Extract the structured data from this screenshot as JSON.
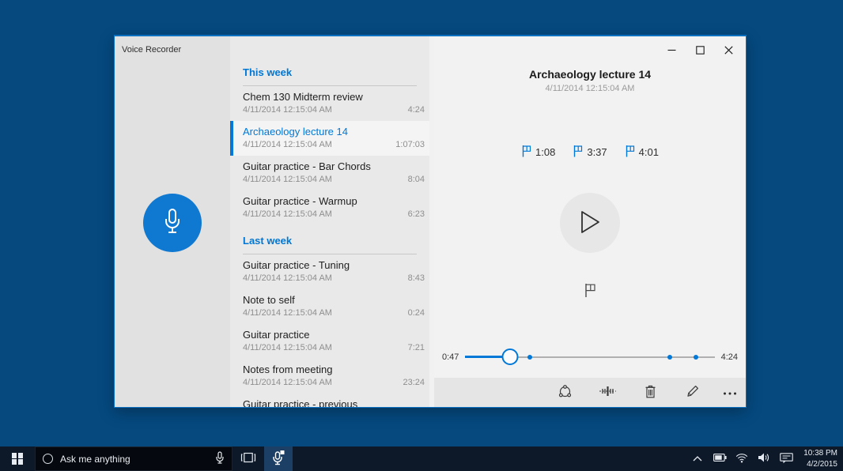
{
  "window": {
    "app_title": "Voice Recorder",
    "controls": [
      "minimize",
      "maximize",
      "close"
    ],
    "accent_color": "#0078d7"
  },
  "recordings": {
    "sections": [
      {
        "label": "This week",
        "items": [
          {
            "title": "Chem 130 Midterm review",
            "date": "4/11/2014 12:15:04 AM",
            "duration": "4:24",
            "selected": false
          },
          {
            "title": "Archaeology lecture 14",
            "date": "4/11/2014 12:15:04 AM",
            "duration": "1:07:03",
            "selected": true
          },
          {
            "title": "Guitar practice - Bar Chords",
            "date": "4/11/2014 12:15:04 AM",
            "duration": "8:04",
            "selected": false
          },
          {
            "title": "Guitar practice - Warmup",
            "date": "4/11/2014 12:15:04 AM",
            "duration": "6:23",
            "selected": false
          }
        ]
      },
      {
        "label": "Last week",
        "items": [
          {
            "title": "Guitar practice - Tuning",
            "date": "4/11/2014 12:15:04 AM",
            "duration": "8:43",
            "selected": false
          },
          {
            "title": "Note to self",
            "date": "4/11/2014 12:15:04 AM",
            "duration": "0:24",
            "selected": false
          },
          {
            "title": "Guitar practice",
            "date": "4/11/2014 12:15:04 AM",
            "duration": "7:21",
            "selected": false
          },
          {
            "title": "Notes from meeting",
            "date": "4/11/2014 12:15:04 AM",
            "duration": "23:24",
            "selected": false
          },
          {
            "title": "Guitar practice - previous",
            "truncated": true
          }
        ]
      }
    ]
  },
  "player": {
    "title": "Archaeology lecture 14",
    "date": "4/11/2014 12:15:04 AM",
    "flags": [
      "1:08",
      "3:37",
      "4:01"
    ],
    "slider": {
      "current": "0:47",
      "total": "4:24",
      "progress_pct": 17.8,
      "marker_pcts": [
        26,
        82,
        92.5
      ]
    },
    "toolbar_icons": [
      "share-icon",
      "trim-icon",
      "delete-icon",
      "rename-icon",
      "more-icon"
    ]
  },
  "taskbar": {
    "search": {
      "placeholder": "Ask me anything"
    },
    "buttons": [
      "start-button",
      "search-box",
      "search-mic",
      "task-view",
      "voice-recorder-app"
    ],
    "tray_icons": [
      "tray-expand-icon",
      "battery-icon",
      "wifi-icon",
      "volume-icon",
      "action-center-icon"
    ],
    "clock": {
      "time": "10:38 PM",
      "date": "4/2/2015"
    }
  },
  "colors": {
    "accent": "#0078d7",
    "desktop": "#05497f",
    "taskbar": "#0d1828",
    "record_button": "#0f78d0"
  }
}
